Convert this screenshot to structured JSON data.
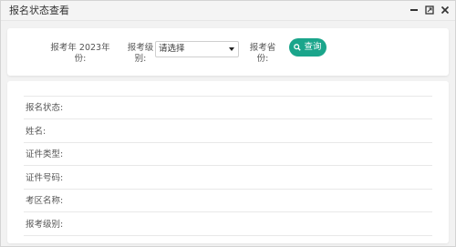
{
  "window": {
    "title": "报名状态查看",
    "controls": [
      "minimize-icon",
      "maximize-icon",
      "close-icon"
    ]
  },
  "search": {
    "year_label_line1": "报考年 2023年",
    "year_label_line2": "份:",
    "level_label_line1": "报考级",
    "level_label_line2": "别:",
    "level_select_value": "请选择",
    "province_label_line1": "报考省",
    "province_label_line2": "份:",
    "query_button": "查询"
  },
  "result": {
    "fields": [
      "报名状态:",
      "姓名:",
      "证件类型:",
      "证件号码:",
      "考区名称:",
      "报考级别:"
    ]
  },
  "colors": {
    "accent": "#1aa58b",
    "background": "#f2f2f2",
    "panel": "#ffffff"
  }
}
